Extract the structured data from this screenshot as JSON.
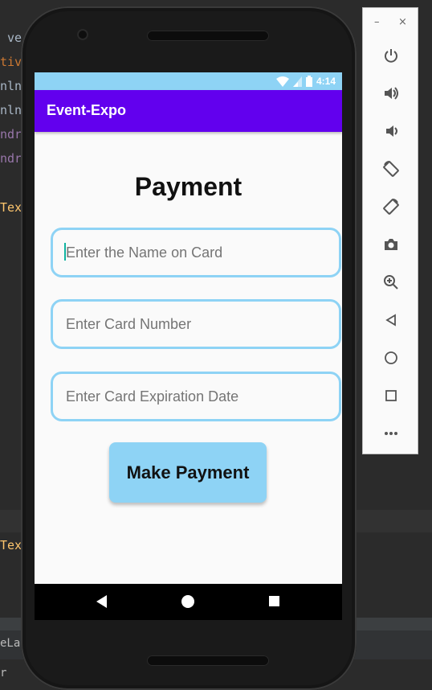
{
  "ide": {
    "lines": [
      {
        "text": " ve",
        "color": "#a9b7c6"
      },
      {
        "text": "tiv",
        "color": "#cc7832"
      },
      {
        "text": "nln",
        "color": "#a9b7c6"
      },
      {
        "text": "nln",
        "color": "#a9b7c6"
      },
      {
        "text": "ndr",
        "color": "#9876aa"
      },
      {
        "text": "ndr",
        "color": "#9876aa"
      },
      {
        "text": "Tex",
        "color": "#ffc66d"
      },
      {
        "text": "Tex",
        "color": "#ffc66d"
      }
    ],
    "bottom_tab": "eLay",
    "bottom_text": "r"
  },
  "device": {
    "status_time": "4:14",
    "app_title": "Event-Expo"
  },
  "screen": {
    "heading": "Payment",
    "fields": {
      "name_placeholder": "Enter the Name on Card",
      "number_placeholder": "Enter Card Number",
      "expiry_placeholder": "Enter Card Expiration Date"
    },
    "button_label": "Make Payment"
  },
  "colors": {
    "status_bar": "#8ed3f5",
    "app_bar": "#6200ee",
    "accent": "#8ed3f5"
  },
  "toolbar": {
    "minimize": "–",
    "close": "×",
    "icons": [
      "power-icon",
      "volume-up-icon",
      "volume-down-icon",
      "rotate-left-icon",
      "rotate-right-icon",
      "camera-icon",
      "zoom-icon",
      "back-icon",
      "home-icon",
      "overview-icon",
      "more-icon"
    ]
  }
}
